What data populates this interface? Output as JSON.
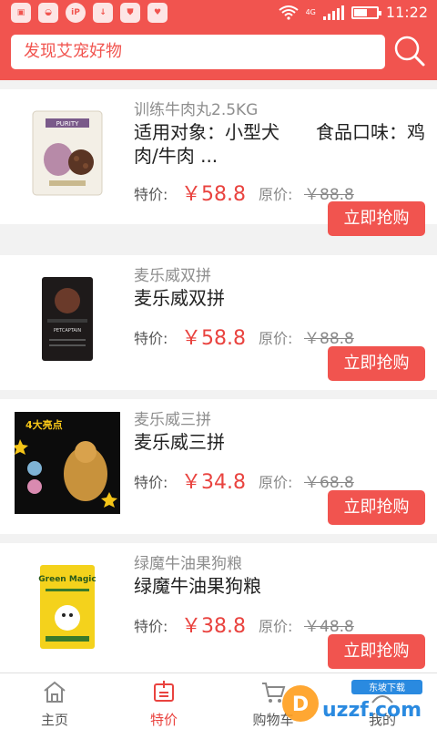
{
  "status_bar": {
    "time": "11:22",
    "app_icons": [
      "image-icon",
      "shield-icon",
      "iply-icon",
      "download-icon",
      "antivirus-icon",
      "shield-heart-icon"
    ],
    "network_label": "4G",
    "battery_level": 0.6
  },
  "search": {
    "text": "发现艾宠好物"
  },
  "products": [
    {
      "subtitle": "训练牛肉丸2.5KG",
      "title": "适用对象：小型犬　　食品口味：鸡肉/牛肉 ...",
      "price_label": "特价:",
      "price": "￥58.8",
      "orig_label": "原价:",
      "orig_price": "￥88.8",
      "buy_label": "立即抢购"
    },
    {
      "subtitle": "麦乐威双拼",
      "title": "麦乐威双拼",
      "price_label": "特价:",
      "price": "￥58.8",
      "orig_label": "原价:",
      "orig_price": "￥88.8",
      "buy_label": "立即抢购"
    },
    {
      "subtitle": "麦乐威三拼",
      "title": "麦乐威三拼",
      "price_label": "特价:",
      "price": "￥34.8",
      "orig_label": "原价:",
      "orig_price": "￥68.8",
      "buy_label": "立即抢购"
    },
    {
      "subtitle": "绿魔牛油果狗粮",
      "title": "绿魔牛油果狗粮",
      "price_label": "特价:",
      "price": "￥38.8",
      "orig_label": "原价:",
      "orig_price": "￥48.8",
      "buy_label": "立即抢购"
    }
  ],
  "product_images": [
    {
      "brand": "PURITY"
    },
    {
      "brand": "PETCAPTAIN"
    },
    {
      "brand": "4大亮点"
    },
    {
      "brand": "Green Magic"
    }
  ],
  "nav": [
    {
      "label": "主页",
      "icon": "home-icon"
    },
    {
      "label": "特价",
      "icon": "sale-tag-icon"
    },
    {
      "label": "购物车",
      "icon": "cart-icon"
    },
    {
      "label": "我的",
      "icon": "user-icon"
    }
  ],
  "watermark": {
    "text": "uzzf.com",
    "tag": "东坡下载"
  },
  "colors": {
    "accent": "#f1544f",
    "price": "#e9433f",
    "background": "#f2f2f2"
  }
}
